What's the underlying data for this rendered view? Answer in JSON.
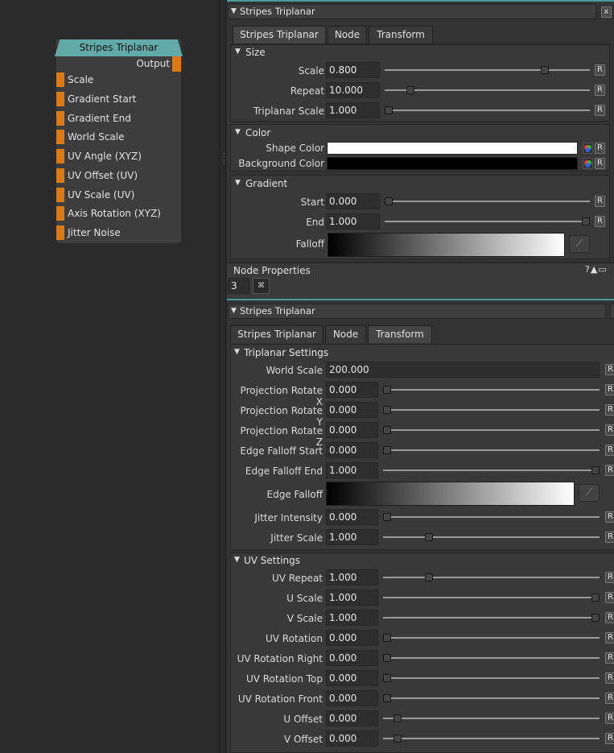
{
  "node": {
    "title": "Stripes Triplanar",
    "output": "Output",
    "ports": [
      "Scale",
      "Gradient Start",
      "Gradient End",
      "World Scale",
      "UV Angle (XYZ)",
      "UV Offset (UV)",
      "UV Scale (UV)",
      "Axis Rotation (XYZ)",
      "Jitter Noise"
    ]
  },
  "top": {
    "header": "Stripes Triplanar",
    "close": "x",
    "tabs": [
      "Stripes Triplanar",
      "Node",
      "Transform"
    ],
    "size": {
      "label": "Size",
      "rows": [
        {
          "label": "Scale",
          "value": "0.800",
          "slider": 0.79
        },
        {
          "label": "Repeat",
          "value": "10.000",
          "slider": 0.11
        },
        {
          "label": "Triplanar Scale",
          "value": "1.000",
          "slider": 0.0
        }
      ]
    },
    "color": {
      "label": "Color",
      "rows": [
        {
          "label": "Shape Color",
          "color": "#ffffff"
        },
        {
          "label": "Background Color",
          "color": "#000000"
        }
      ]
    },
    "gradient": {
      "label": "Gradient",
      "rows": [
        {
          "label": "Start",
          "value": "0.000",
          "slider": 0.0
        },
        {
          "label": "End",
          "value": "1.000",
          "slider": 1.0
        }
      ],
      "falloff": "Falloff"
    }
  },
  "props": {
    "title": "Node Properties",
    "icons": "?▲▭",
    "field": "3",
    "button": "⌘"
  },
  "bottom": {
    "header": "Stripes Triplanar",
    "tabs": [
      "Stripes Triplanar",
      "Node",
      "Transform"
    ],
    "triplanar": {
      "label": "Triplanar Settings",
      "world_scale_label": "World Scale",
      "world_scale": "200.000",
      "rows": [
        {
          "label": "Projection Rotate X",
          "value": "0.000",
          "slider": 0.0
        },
        {
          "label": "Projection Rotate Y",
          "value": "0.000",
          "slider": 0.0
        },
        {
          "label": "Projection Rotate Z",
          "value": "0.000",
          "slider": 0.0
        },
        {
          "label": "Edge Falloff Start",
          "value": "0.000",
          "slider": 0.0
        },
        {
          "label": "Edge Falloff End",
          "value": "1.000",
          "slider": 1.0
        }
      ],
      "edge_falloff": "Edge Falloff",
      "rows2": [
        {
          "label": "Jitter Intensity",
          "value": "0.000",
          "slider": 0.0
        },
        {
          "label": "Jitter Scale",
          "value": "1.000",
          "slider": 0.2
        }
      ]
    },
    "uv": {
      "label": "UV Settings",
      "rows": [
        {
          "label": "UV Repeat",
          "value": "1.000",
          "slider": 0.2
        },
        {
          "label": "U Scale",
          "value": "1.000",
          "slider": 1.0
        },
        {
          "label": "V Scale",
          "value": "1.000",
          "slider": 1.0
        },
        {
          "label": "UV Rotation",
          "value": "0.000",
          "slider": 0.0
        },
        {
          "label": "UV Rotation Right",
          "value": "0.000",
          "slider": 0.0
        },
        {
          "label": "UV Rotation Top",
          "value": "0.000",
          "slider": 0.0
        },
        {
          "label": "UV Rotation Front",
          "value": "0.000",
          "slider": 0.0
        },
        {
          "label": "U Offset",
          "value": "0.000",
          "slider": 0.05
        },
        {
          "label": "V Offset",
          "value": "0.000",
          "slider": 0.05
        }
      ]
    }
  },
  "reset_label": "R",
  "colors": {
    "node_title": "#62aaa8",
    "port": "#d97a14",
    "accent": "#4a9a98"
  }
}
